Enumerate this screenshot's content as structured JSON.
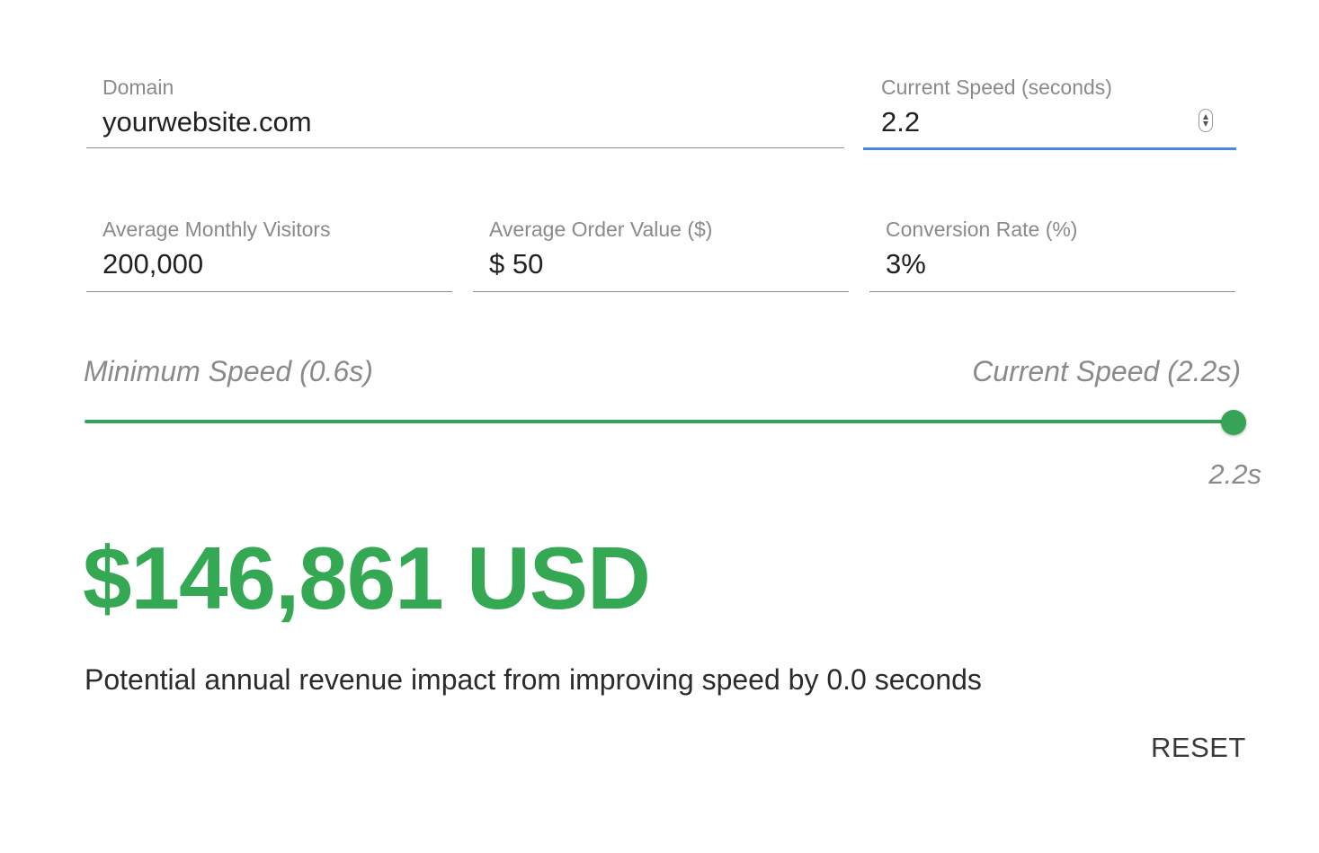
{
  "fields": {
    "domain": {
      "label": "Domain",
      "value": "yourwebsite.com"
    },
    "current_speed": {
      "label": "Current Speed (seconds)",
      "value": "2.2"
    },
    "monthly_visitors": {
      "label": "Average Monthly Visitors",
      "value": "200,000"
    },
    "order_value": {
      "label": "Average Order Value ($)",
      "value": "$ 50"
    },
    "conversion_rate": {
      "label": "Conversion Rate (%)",
      "value": "3%"
    }
  },
  "slider": {
    "min_label": "Minimum Speed (0.6s)",
    "max_label": "Current Speed (2.2s)",
    "value_label": "2.2s",
    "min": 0.6,
    "max": 2.2,
    "value": 2.2
  },
  "result": {
    "amount": "$146,861 USD",
    "caption": "Potential annual revenue impact from improving speed by 0.0 seconds"
  },
  "actions": {
    "reset_label": "RESET"
  },
  "colors": {
    "accent_green": "#34a853",
    "focus_blue": "#4a86e8"
  }
}
